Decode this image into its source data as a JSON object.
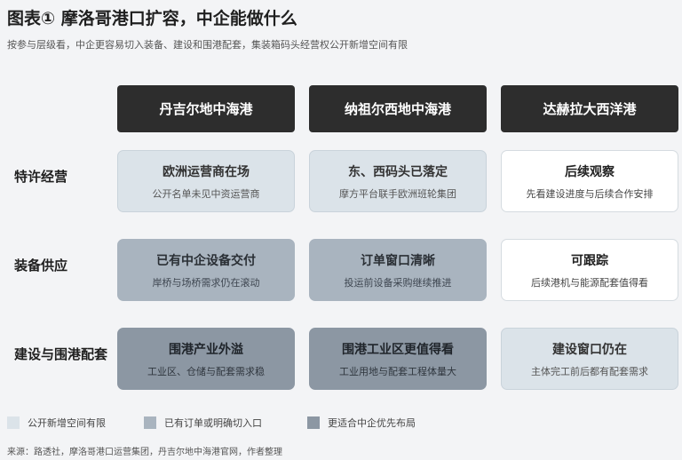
{
  "title": "图表① 摩洛哥港口扩容，中企能做什么",
  "subtitle": "按参与层级看，中企更容易切入装备、建设和围港配套，集装箱码头经营权公开新增空间有限",
  "columns": [
    "丹吉尔地中海港",
    "纳祖尔西地中海港",
    "达赫拉大西洋港"
  ],
  "rows": [
    {
      "label": "特许经营",
      "cells": [
        {
          "title": "欧洲运营商在场",
          "sub": "公开名单未见中资运营商",
          "level": "open-limited"
        },
        {
          "title": "东、西码头已落定",
          "sub": "摩方平台联手欧洲班轮集团",
          "level": "open-limited"
        },
        {
          "title": "后续观察",
          "sub": "先看建设进度与后续合作安排",
          "level": "none"
        }
      ]
    },
    {
      "label": "装备供应",
      "cells": [
        {
          "title": "已有中企设备交付",
          "sub": "岸桥与场桥需求仍在滚动",
          "level": "has-orders"
        },
        {
          "title": "订单窗口清晰",
          "sub": "投运前设备采购继续推进",
          "level": "has-orders"
        },
        {
          "title": "可跟踪",
          "sub": "后续港机与能源配套值得看",
          "level": "none"
        }
      ]
    },
    {
      "label": "建设与围港配套",
      "cells": [
        {
          "title": "围港产业外溢",
          "sub": "工业区、仓储与配套需求稳",
          "level": "priority"
        },
        {
          "title": "围港工业区更值得看",
          "sub": "工业用地与配套工程体量大",
          "level": "priority"
        },
        {
          "title": "建设窗口仍在",
          "sub": "主体完工前后都有配套需求",
          "level": "open-limited"
        }
      ]
    }
  ],
  "legend": [
    {
      "label": "公开新增空间有限",
      "color": "#dbe3e9"
    },
    {
      "label": "已有订单或明确切入口",
      "color": "#a9b4bf"
    },
    {
      "label": "更适合中企优先布局",
      "color": "#8c97a3"
    }
  ],
  "source": "来源：路透社，摩洛哥港口运营集团，丹吉尔地中海港官网，作者整理"
}
